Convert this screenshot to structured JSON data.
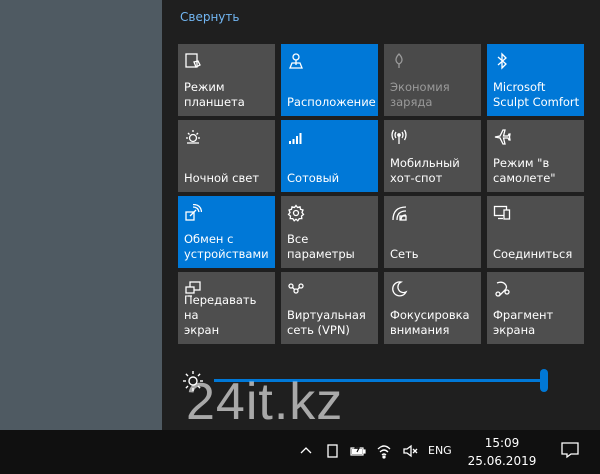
{
  "action_center": {
    "collapse_label": "Свернуть",
    "tiles": [
      {
        "label": "Режим\nпланшета",
        "icon": "tablet-mode-icon",
        "state": "off"
      },
      {
        "label": "Расположение",
        "icon": "location-icon",
        "state": "on"
      },
      {
        "label": "Экономия\nзаряда",
        "icon": "battery-saver-icon",
        "state": "disabled"
      },
      {
        "label": "Microsoft\nSculpt Comfort",
        "icon": "bluetooth-icon",
        "state": "on"
      },
      {
        "label": "Ночной свет",
        "icon": "night-light-icon",
        "state": "off"
      },
      {
        "label": "Сотовый",
        "icon": "cellular-icon",
        "state": "on"
      },
      {
        "label": "Мобильный\nхот-спот",
        "icon": "mobile-hotspot-icon",
        "state": "off"
      },
      {
        "label": "Режим \"в\nсамолете\"",
        "icon": "airplane-icon",
        "state": "off"
      },
      {
        "label": "Обмен с\nустройствами",
        "icon": "nearby-sharing-icon",
        "state": "on"
      },
      {
        "label": "Все\nпараметры",
        "icon": "gear-icon",
        "state": "off"
      },
      {
        "label": "Сеть",
        "icon": "network-icon",
        "state": "off"
      },
      {
        "label": "Соединиться",
        "icon": "connect-icon",
        "state": "off"
      },
      {
        "label": "Передавать на\nэкран",
        "icon": "project-icon",
        "state": "off"
      },
      {
        "label": "Виртуальная\nсеть (VPN)",
        "icon": "vpn-icon",
        "state": "off"
      },
      {
        "label": "Фокусировка\nвнимания",
        "icon": "focus-assist-icon",
        "state": "off"
      },
      {
        "label": "Фрагмент\nэкрана",
        "icon": "screen-snip-icon",
        "state": "off"
      }
    ],
    "brightness": {
      "icon": "brightness-icon",
      "level": 1.0
    }
  },
  "watermark": "24it.kz",
  "taskbar": {
    "tray_icons": [
      "chevron-up-icon",
      "tablet-icon",
      "battery-charging-icon",
      "wifi-icon",
      "volume-muted-icon"
    ],
    "language": "ENG",
    "time": "15:09",
    "date": "25.06.2019",
    "notification_icon": "notification-icon"
  },
  "colors": {
    "accent": "#0078d7",
    "tile_off": "#4e4e4e",
    "panel": "#1f1f1f",
    "link": "#72b6f2"
  }
}
